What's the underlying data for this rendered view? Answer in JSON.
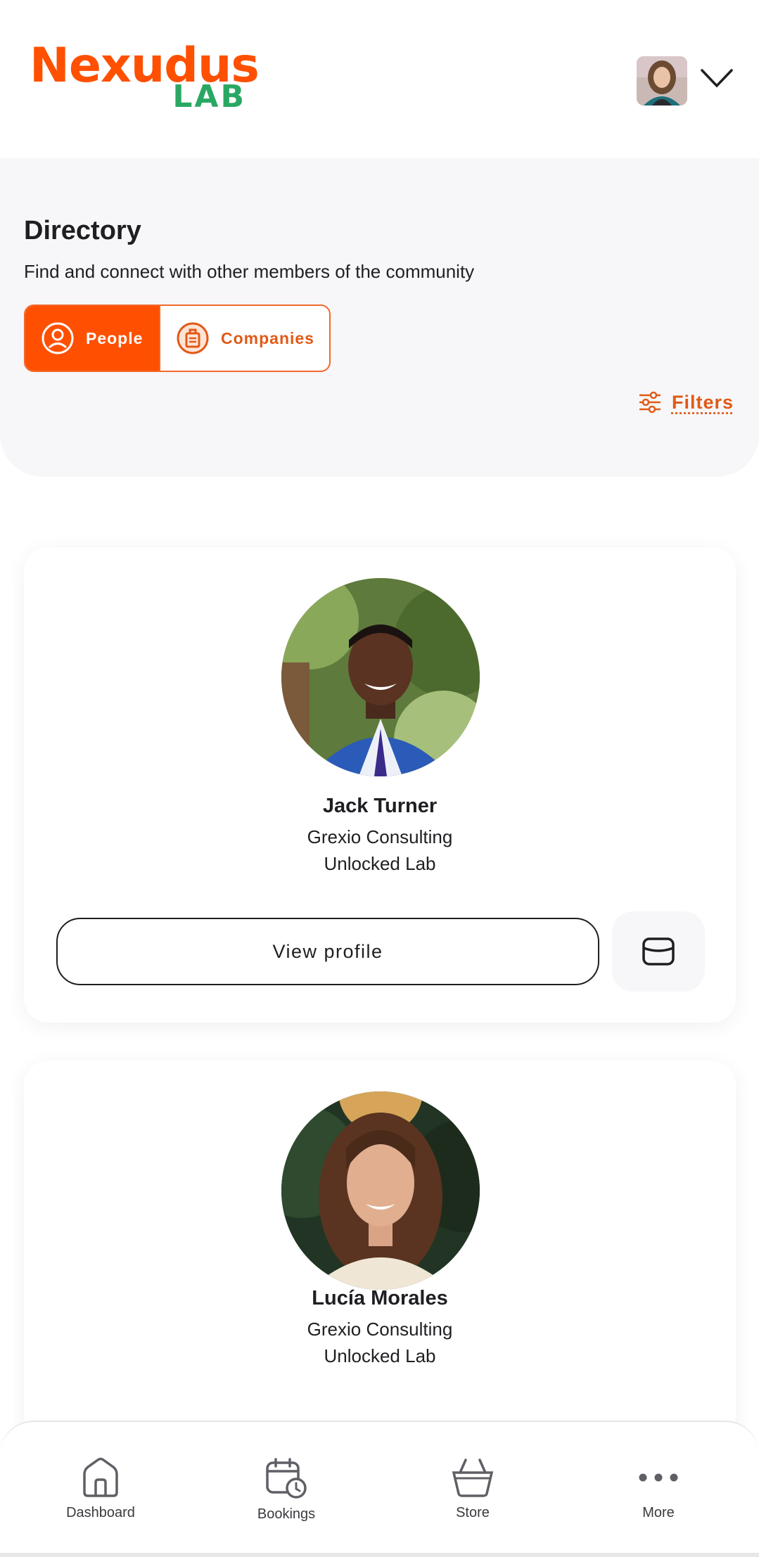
{
  "header": {
    "logo_text": "Nexudus",
    "logo_sub": "LAB",
    "user_avatar_alt": "User avatar"
  },
  "hero": {
    "title": "Directory",
    "subtitle": "Find and connect with other members of the community",
    "tabs": [
      {
        "label": "People",
        "active": true,
        "icon": "person-circle-icon"
      },
      {
        "label": "Companies",
        "active": false,
        "icon": "building-circle-icon"
      }
    ],
    "filters_label": "Filters"
  },
  "members": [
    {
      "name": "Jack Turner",
      "company": "Grexio Consulting",
      "location": "Unlocked Lab",
      "view_label": "View profile"
    },
    {
      "name": "Lucía Morales",
      "company": "Grexio Consulting",
      "location": "Unlocked Lab"
    }
  ],
  "bottom_nav": {
    "items": [
      {
        "label": "Dashboard",
        "icon": "home-icon"
      },
      {
        "label": "Bookings",
        "icon": "calendar-clock-icon"
      },
      {
        "label": "Store",
        "icon": "basket-icon"
      },
      {
        "label": "More",
        "icon": "more-dots-icon"
      }
    ]
  },
  "colors": {
    "accent": "#fe5000",
    "logo_green": "#2aa863",
    "surface": "#f7f7f9"
  }
}
